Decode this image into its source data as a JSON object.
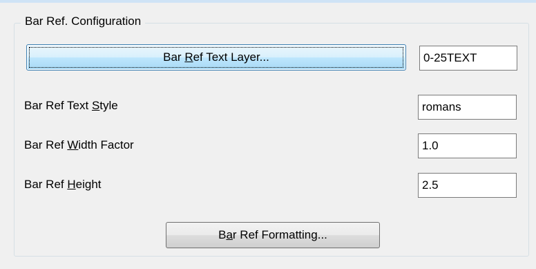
{
  "group": {
    "title": "Bar Ref. Configuration"
  },
  "text_layer_button": {
    "label_pre": "Bar ",
    "label_key": "R",
    "label_post": "ef Text Layer..."
  },
  "text_layer_field": {
    "value": "0-25TEXT"
  },
  "text_style": {
    "label_pre": "Bar Ref Text ",
    "label_key": "S",
    "label_post": "tyle",
    "value": "romans"
  },
  "width_factor": {
    "label_pre": "Bar Ref ",
    "label_key": "W",
    "label_post": "idth Factor",
    "value": "1.0"
  },
  "height": {
    "label_pre": "Bar Ref ",
    "label_key": "H",
    "label_post": "eight",
    "value": "2.5"
  },
  "formatting_button": {
    "label_pre": "B",
    "label_key": "a",
    "label_post": "r Ref Formatting..."
  }
}
